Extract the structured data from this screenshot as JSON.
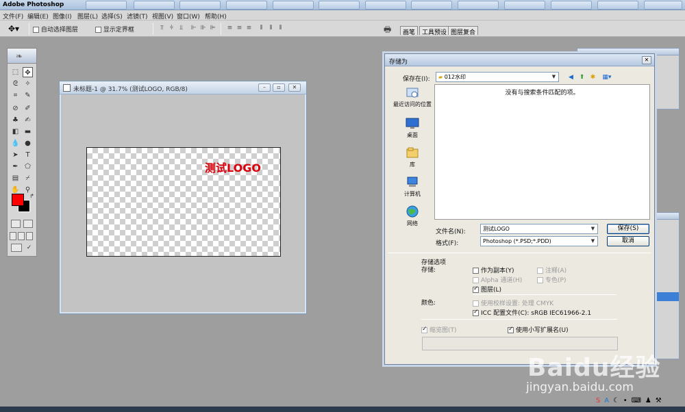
{
  "app": {
    "title": "Adobe Photoshop"
  },
  "menu": [
    "文件(F)",
    "编辑(E)",
    "图像(I)",
    "图层(L)",
    "选择(S)",
    "滤镜(T)",
    "视图(V)",
    "窗口(W)",
    "帮助(H)"
  ],
  "options": {
    "auto_select": "自动选择图层",
    "show_bounds": "显示定界框"
  },
  "palette_well": {
    "tabs": [
      "画笔",
      "工具预设",
      "图层复合"
    ]
  },
  "document": {
    "title": "未标题-1 @ 31.7% (测试LOGO, RGB/8)",
    "logo_text": "测试LOGO"
  },
  "colors": {
    "foreground": "#ff0000",
    "background": "#000000",
    "logo": "#d9000b"
  },
  "dialog": {
    "title": "存储为",
    "save_in_label": "保存在(I):",
    "save_in_value": "012水印",
    "empty_message": "没有与搜索条件匹配的项。",
    "places": [
      "最近访问的位置",
      "桌面",
      "库",
      "计算机",
      "网络"
    ],
    "filename_label": "文件名(N):",
    "filename_value": "测试LOGO",
    "format_label": "格式(F):",
    "format_value": "Photoshop (*.PSD;*.PDD)",
    "save_button": "保存(S)",
    "cancel_button": "取消",
    "options_title": "存储选项",
    "save_label": "存储:",
    "as_copy": "作为副本(Y)",
    "annotations": "注释(A)",
    "alpha": "Alpha 通道(H)",
    "spot": "专色(P)",
    "layers": "图层(L)",
    "color_label": "颜色:",
    "proof": "使用校样设置: 处理 CMYK",
    "icc": "ICC 配置文件(C): sRGB IEC61966-2.1",
    "thumbnail": "缩览图(T)",
    "lowercase": "使用小写扩展名(U)"
  },
  "watermark": {
    "logo": "Baidu经验",
    "url": "jingyan.baidu.com"
  }
}
